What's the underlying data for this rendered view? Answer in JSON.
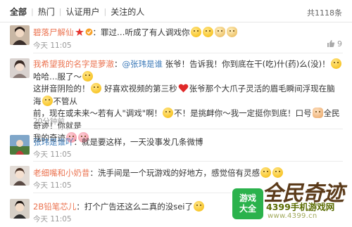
{
  "tabs": [
    {
      "label": "全部"
    },
    {
      "label": "热门"
    },
    {
      "label": "认证用户"
    },
    {
      "label": "关注的人"
    }
  ],
  "total": "共1118条",
  "comments": [
    {
      "user": "碧落尸解仙",
      "text": "：罪过…听成了有人调戏你",
      "time": "今天 11:05",
      "likes": "9"
    },
    {
      "user": "我希望我的名字是萝澈",
      "mention": "@张玮是谁",
      "text1": " 张爷！告诉我！你到底在干(吃)什(药)么(没)！",
      "text2": "哈哈…服了～",
      "text3": "这拼音阴险的！",
      "text4": " 好喜欢视频的第三秒",
      "text5": "张爷那个大爪子灵活的眉毛瞬间浮现在脑海",
      "text6": "不管从",
      "text7": "前，现在或未来～若有人\"调戏\"啊！",
      "text8": "不！是挑衅你～我一定挺你到底！口号",
      "text9": "全民奇迹！你就是",
      "text10": "我的奇迹",
      "time": "20分钟前"
    },
    {
      "user": "张玮是谁吖",
      "text": "：就是要这样，一天没事发几条微博",
      "time": "今天 11:05"
    },
    {
      "user": "老细嘴和小奶昔",
      "text": "：洗手间是一个玩游戏的好地方，感觉倍有灵感",
      "time": "今天 11:05"
    },
    {
      "user": "2B铅笔芯儿",
      "text": "：打个广告还这么二真的没sei了",
      "time": "今天 11:05"
    }
  ],
  "promo": {
    "logo_line1": "游戏",
    "logo_line2": "大全",
    "title": "全民奇迹",
    "site": "4399手机游戏网",
    "url": "www.4399.cn"
  },
  "colors": {
    "username": "#eb7350",
    "link": "#3b79b8",
    "meta": "#999999",
    "promo_green": "#2bb24c"
  }
}
